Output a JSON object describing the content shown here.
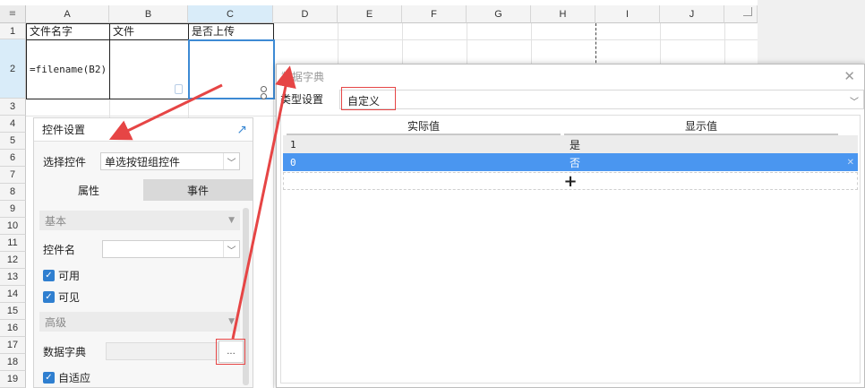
{
  "sheet": {
    "corner": "≡",
    "columns": [
      "A",
      "B",
      "C",
      "D",
      "E",
      "F",
      "G",
      "H",
      "I",
      "J"
    ],
    "rows": [
      "1",
      "2",
      "3",
      "4",
      "5",
      "6",
      "7",
      "8",
      "9",
      "10",
      "11",
      "12",
      "13",
      "14",
      "15",
      "16",
      "17",
      "18",
      "19"
    ],
    "cells": {
      "A1": "文件名字",
      "B1": "文件",
      "C1": "是否上传",
      "A2": "=filename(B2)"
    }
  },
  "panel": {
    "title": "控件设置",
    "select_label": "选择控件",
    "select_value": "单选按钮组控件",
    "tab_attr": "属性",
    "tab_event": "事件",
    "section_basic": "基本",
    "name_label": "控件名",
    "name_value": "",
    "enabled_label": "可用",
    "visible_label": "可见",
    "section_advanced": "高级",
    "dict_label": "数据字典",
    "dict_button": "...",
    "autofit_label": "自适应"
  },
  "dialog": {
    "title": "数据字典",
    "type_label": "类型设置",
    "type_value": "自定义",
    "col_actual": "实际值",
    "col_display": "显示值",
    "rows": [
      {
        "actual": "1",
        "display": "是"
      },
      {
        "actual": "0",
        "display": "否"
      }
    ],
    "add_symbol": "+"
  },
  "colors": {
    "selection": "#3d8ad4",
    "highlight_red": "#e64545",
    "selected_row": "#4a96f0"
  }
}
